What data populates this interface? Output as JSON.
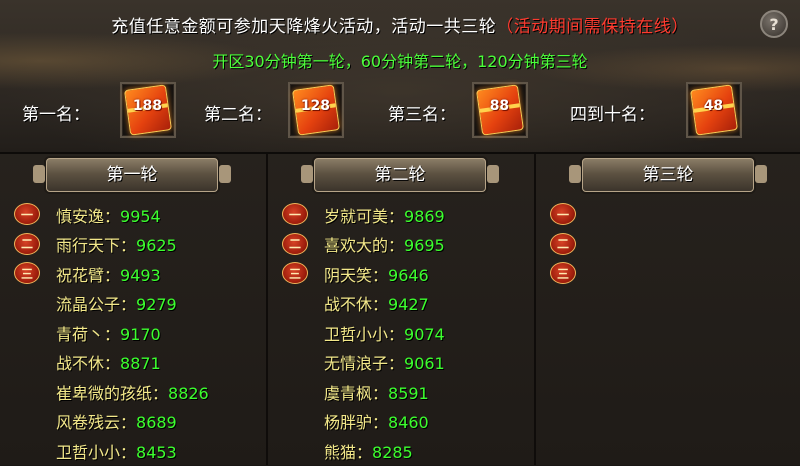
{
  "header": {
    "title": "充值任意金额可参加天降烽火活动，活动一共三轮",
    "warning": "（活动期间需保持在线）",
    "subtitle": "开区30分钟第一轮，60分钟第二轮，120分钟第三轮",
    "help_label": "?"
  },
  "rewards": [
    {
      "label": "第一名：",
      "amount": "188"
    },
    {
      "label": "第二名：",
      "amount": "128"
    },
    {
      "label": "第三名：",
      "amount": "88"
    },
    {
      "label": "四到十名：",
      "amount": "48"
    }
  ],
  "rank_medals": [
    "一",
    "二",
    "三"
  ],
  "rounds": [
    {
      "title": "第一轮",
      "entries": [
        {
          "name": "慎安逸：",
          "score": "9954"
        },
        {
          "name": "雨行天下：",
          "score": "9625"
        },
        {
          "name": "祝花臂：",
          "score": "9493"
        },
        {
          "name": "流晶公子：",
          "score": "9279"
        },
        {
          "name": "青荷丶：",
          "score": "9170"
        },
        {
          "name": "战不休：",
          "score": "8871"
        },
        {
          "name": "崔卑微的孩纸：",
          "score": "8826"
        },
        {
          "name": "风卷残云：",
          "score": "8689"
        },
        {
          "name": "卫哲小小：",
          "score": "8453"
        }
      ]
    },
    {
      "title": "第二轮",
      "entries": [
        {
          "name": "岁就可美：",
          "score": "9869"
        },
        {
          "name": "喜欢大的：",
          "score": "9695"
        },
        {
          "name": "阴天笑：",
          "score": "9646"
        },
        {
          "name": "战不休：",
          "score": "9427"
        },
        {
          "name": "卫哲小小：",
          "score": "9074"
        },
        {
          "name": "无情浪子：",
          "score": "9061"
        },
        {
          "name": "虞青枫：",
          "score": "8591"
        },
        {
          "name": "杨胖驴：",
          "score": "8460"
        },
        {
          "name": "熊猫：",
          "score": "8285"
        }
      ]
    },
    {
      "title": "第三轮",
      "entries": []
    }
  ],
  "colors": {
    "name": "#f3e88a",
    "score": "#3cff2e",
    "warning": "#ff3b2f",
    "subtitle": "#4cff3a"
  }
}
